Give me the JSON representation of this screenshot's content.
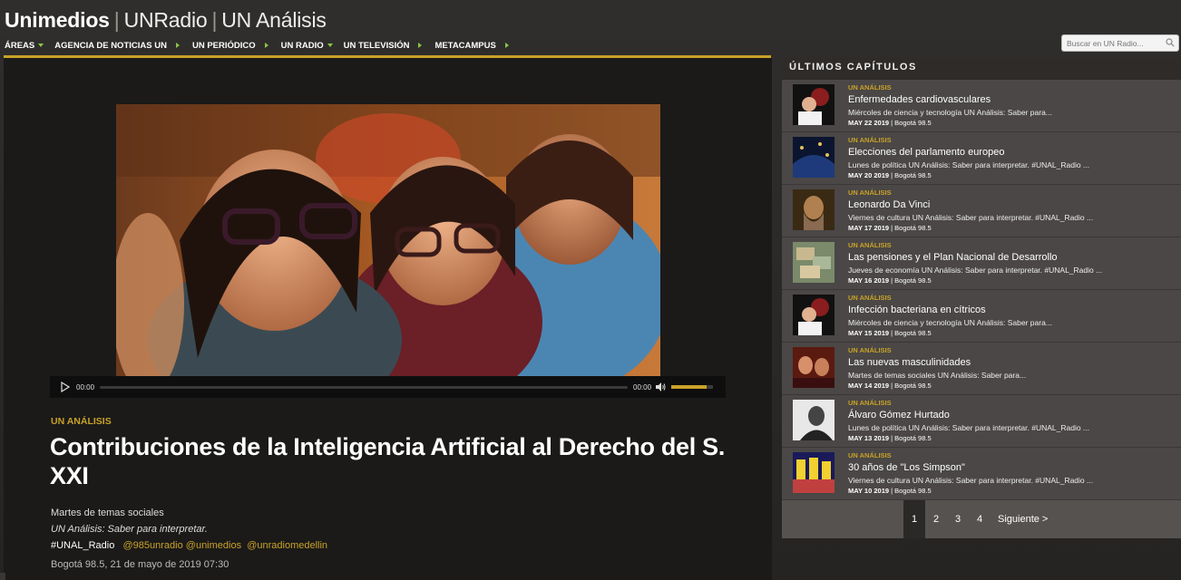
{
  "header": {
    "brand": {
      "main": "Unimedios",
      "sep1": "|",
      "radio": "UNRadio",
      "sep2": "|",
      "analysis": "UN Análisis"
    },
    "nav": [
      {
        "label": "ÁREAS"
      },
      {
        "label": "AGENCIA DE NOTICIAS UN"
      },
      {
        "label": "UN PERIÓDICO"
      },
      {
        "label": "UN RADIO"
      },
      {
        "label": "UN TELEVISIÓN"
      },
      {
        "label": "METACAMPUS"
      }
    ],
    "search": {
      "placeholder": "Buscar en UN Radio..."
    }
  },
  "player": {
    "current_time": "00:00",
    "duration": "00:00",
    "volume_fraction": 0.85
  },
  "article": {
    "kicker": "UN ANÁLISIS",
    "title": "Contribuciones de la Inteligencia Artificial al Derecho del S. XXI",
    "line1": "Martes de temas sociales",
    "line2": "UN Análisis: Saber para interpretar.",
    "hashtag": "#UNAL_Radio",
    "tag1": "@985unradio",
    "tag2": "@unimedios",
    "tag3": "@unradiomedellin",
    "meta": "Bogotá 98.5, 21 de mayo de 2019 07:30"
  },
  "sidebar": {
    "heading": "ÚLTIMOS CAPÍTULOS",
    "episodes": [
      {
        "kicker": "UN ANÁLISIS",
        "title": "Enfermedades cardiovasculares",
        "desc": "Miércoles de ciencia y tecnología UN Análisis: Saber para...",
        "date": "MAY 22 2019",
        "station": "| Bogotá 98.5"
      },
      {
        "kicker": "UN ANÁLISIS",
        "title": "Elecciones del parlamento europeo",
        "desc": "Lunes de política UN Análisis: Saber para interpretar. #UNAL_Radio ...",
        "date": "MAY 20 2019",
        "station": "| Bogotá 98.5"
      },
      {
        "kicker": "UN ANÁLISIS",
        "title": "Leonardo Da Vinci",
        "desc": "Viernes de cultura UN Análisis: Saber para interpretar. #UNAL_Radio ...",
        "date": "MAY 17 2019",
        "station": "| Bogotá 98.5"
      },
      {
        "kicker": "UN ANÁLISIS",
        "title": "Las pensiones y el Plan Nacional de Desarrollo",
        "desc": "Jueves de economía UN Análisis: Saber para interpretar. #UNAL_Radio ...",
        "date": "MAY 16 2019",
        "station": "| Bogotá 98.5"
      },
      {
        "kicker": "UN ANÁLISIS",
        "title": "Infección bacteriana en cítricos",
        "desc": "Miércoles de ciencia y tecnología UN Análisis: Saber para...",
        "date": "MAY 15 2019",
        "station": "| Bogotá 98.5"
      },
      {
        "kicker": "UN ANÁLISIS",
        "title": "Las nuevas masculinidades",
        "desc": "Martes de temas sociales UN Análisis: Saber para...",
        "date": "MAY 14 2019",
        "station": "| Bogotá 98.5"
      },
      {
        "kicker": "UN ANÁLISIS",
        "title": "Álvaro Gómez Hurtado",
        "desc": "Lunes de política UN Análisis: Saber para interpretar. #UNAL_Radio ...",
        "date": "MAY 13 2019",
        "station": "| Bogotá 98.5"
      },
      {
        "kicker": "UN ANÁLISIS",
        "title": "30 años de \"Los Simpson\"",
        "desc": "Viernes de cultura UN Análisis: Saber para interpretar. #UNAL_Radio ...",
        "date": "MAY 10 2019",
        "station": "| Bogotá 98.5"
      }
    ],
    "pager": {
      "pages": [
        "1",
        "2",
        "3",
        "4"
      ],
      "active": "1",
      "next": "Siguiente >"
    }
  },
  "colors": {
    "accent": "#c9a227",
    "nav_arrow": "#8bc34a",
    "panel": "#4a4746",
    "main_bg": "#1b1a19"
  }
}
